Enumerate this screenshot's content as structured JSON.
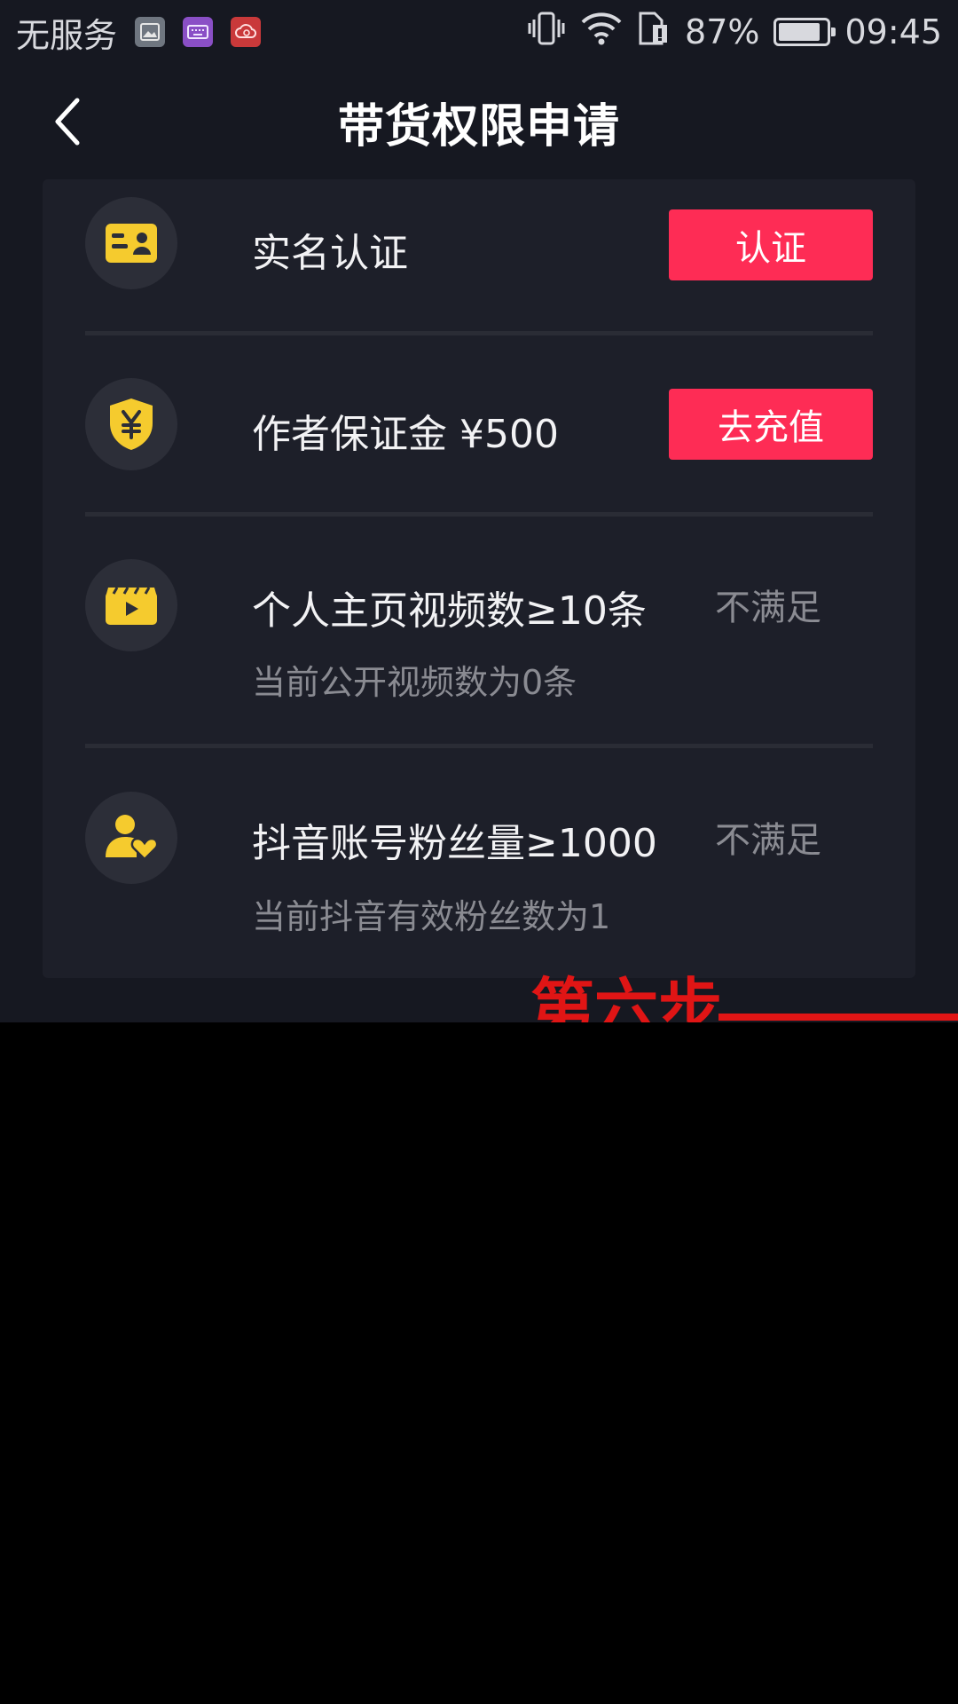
{
  "status_bar": {
    "carrier": "无服务",
    "battery_percent": "87%",
    "battery_level": 0.87,
    "time": "09:45",
    "icons": [
      "gallery-icon",
      "keyboard-icon",
      "cloud-sync-icon",
      "vibrate-icon",
      "wifi-icon",
      "sim-icon",
      "battery-icon"
    ]
  },
  "header": {
    "title": "带货权限申请",
    "back_icon": "chevron-left-icon"
  },
  "requirements": [
    {
      "title": "实名认证",
      "icon": "id-card-icon",
      "action_label": "认证"
    },
    {
      "title": "作者保证金 ¥500",
      "icon": "shield-yen-icon",
      "action_label": "去充值"
    },
    {
      "title": "个人主页视频数≥10条",
      "subtitle": "当前公开视频数为0条",
      "icon": "video-clapper-icon",
      "status": "不满足"
    },
    {
      "title": "抖音账号粉丝量≥1000",
      "subtitle": "当前抖音有效粉丝数为1",
      "icon": "fans-heart-icon",
      "status": "不满足"
    }
  ],
  "annotation": {
    "text": "第六步",
    "color": "#e01515"
  },
  "colors": {
    "accent": "#fe2c55",
    "icon_yellow": "#f5cb2e",
    "background": "#161821",
    "card": "#1d1f29"
  }
}
